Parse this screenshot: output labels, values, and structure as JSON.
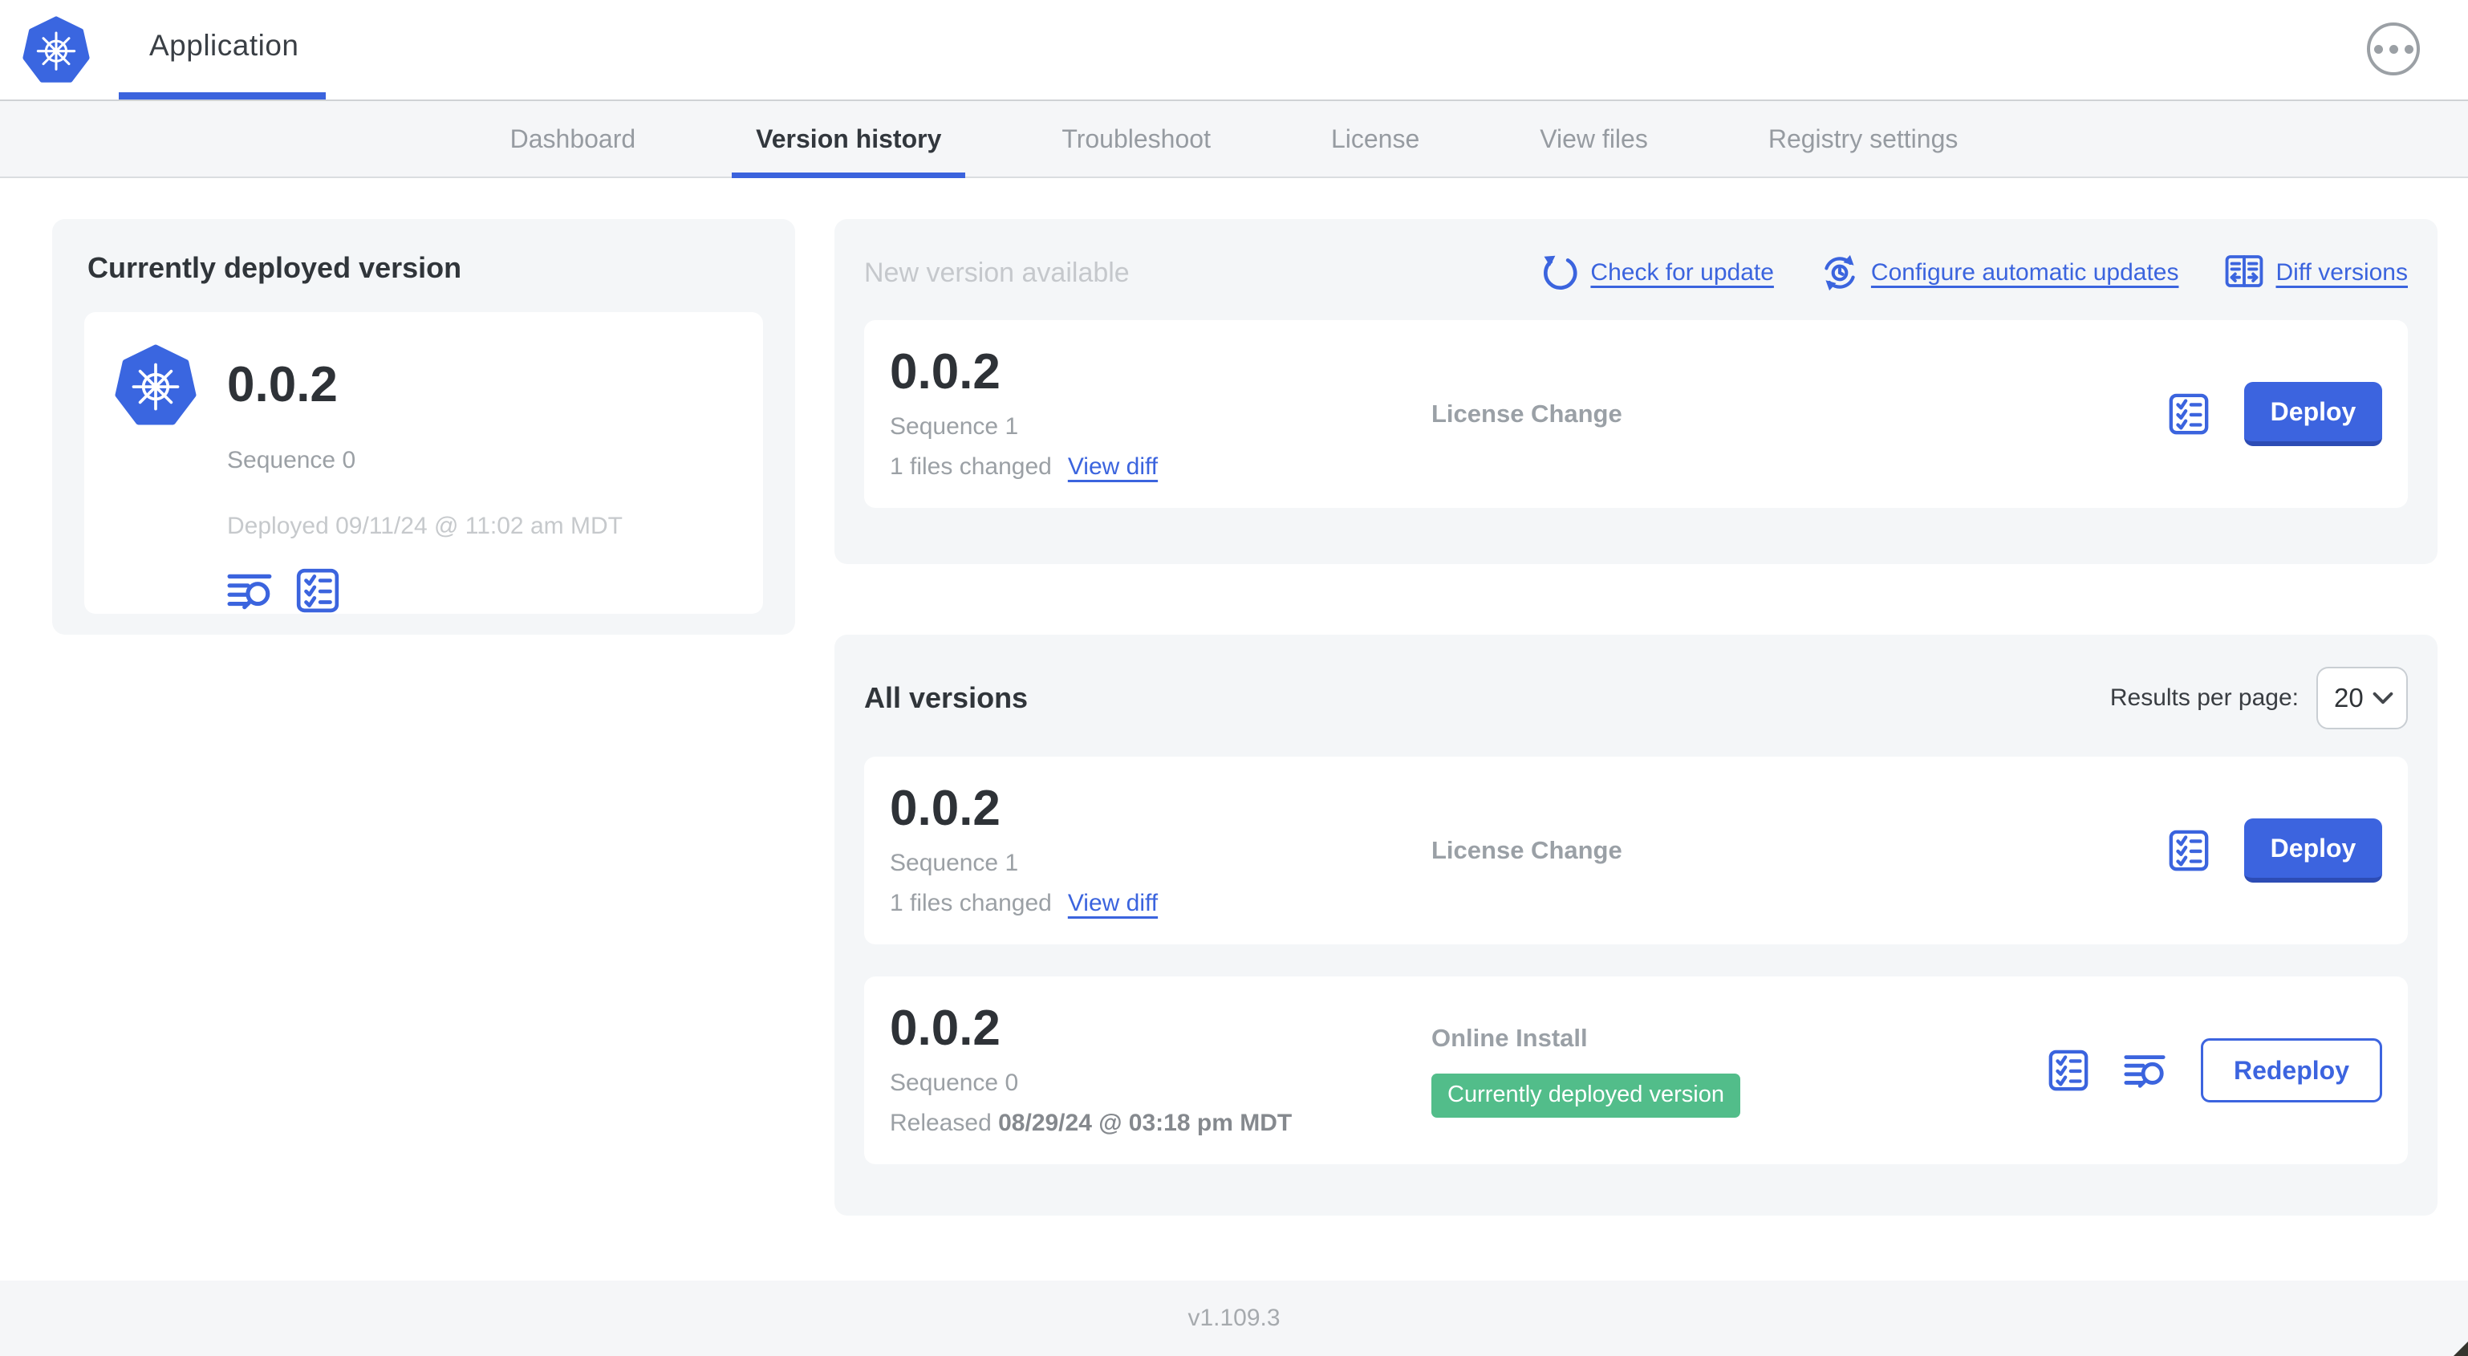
{
  "colors": {
    "accent_blue": "#3b64de",
    "badge_green": "#52bd8a",
    "panel_gray": "#f4f6f8",
    "button_blue": "#3c64df"
  },
  "header": {
    "app_title": "Application"
  },
  "nav": {
    "tabs": [
      {
        "label": "Dashboard"
      },
      {
        "label": "Version history",
        "active": true
      },
      {
        "label": "Troubleshoot"
      },
      {
        "label": "License"
      },
      {
        "label": "View files"
      },
      {
        "label": "Registry settings"
      }
    ]
  },
  "current_deployed": {
    "heading": "Currently deployed version",
    "version": "0.0.2",
    "sequence": "Sequence 0",
    "deployed": "Deployed 09/11/24 @ 11:02 am MDT"
  },
  "new_version": {
    "heading": "New version available",
    "actions": {
      "check": "Check for update",
      "configure": "Configure automatic updates",
      "diff": "Diff versions"
    },
    "card": {
      "version": "0.0.2",
      "sequence": "Sequence 1",
      "files_changed": "1 files changed",
      "view_diff": "View diff",
      "source": "License Change",
      "deploy": "Deploy"
    }
  },
  "all_versions": {
    "heading": "All versions",
    "results_per_page": {
      "label": "Results per page:",
      "value": "20"
    },
    "rows": [
      {
        "version": "0.0.2",
        "sequence": "Sequence 1",
        "files_changed": "1 files changed",
        "view_diff": "View diff",
        "source": "License Change",
        "action": "Deploy"
      },
      {
        "version": "0.0.2",
        "sequence": "Sequence 0",
        "released_label": "Released",
        "released_date": "08/29/24 @ 03:18 pm MDT",
        "source": "Online Install",
        "badge": "Currently deployed version",
        "action": "Redeploy"
      }
    ]
  },
  "footer": {
    "app_version": "v1.109.3"
  }
}
